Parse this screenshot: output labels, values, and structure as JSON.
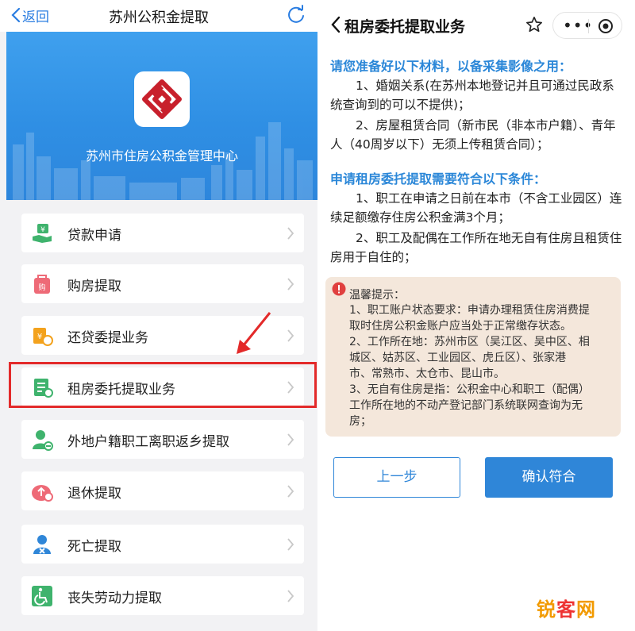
{
  "left": {
    "back_label": "返回",
    "title": "苏州公积金提取",
    "banner_text": "苏州市住房公积金管理中心",
    "menu": [
      {
        "label": "贷款申请",
        "icon": "loan-icon"
      },
      {
        "label": "购房提取",
        "icon": "house-purchase-icon"
      },
      {
        "label": "还贷委提业务",
        "icon": "repayment-icon"
      },
      {
        "label": "租房委托提取业务",
        "icon": "rent-document-icon"
      },
      {
        "label": "外地户籍职工离职返乡提取",
        "icon": "person-leave-icon"
      },
      {
        "label": "退休提取",
        "icon": "retire-icon"
      },
      {
        "label": "死亡提取",
        "icon": "person-death-icon"
      },
      {
        "label": "丧失劳动力提取",
        "icon": "wheelchair-icon"
      }
    ]
  },
  "right": {
    "title": "租房委托提取业务",
    "section1_heading": "请您准备好以下材料，以备采集影像之用：",
    "section1_items": [
      "1、婚姻关系(在苏州本地登记并且可通过民政系统查询到的可以不提供)；",
      "2、房屋租赁合同（新市民（非本市户籍）、青年人（40周岁以下）无须上传租赁合同）；"
    ],
    "section2_heading": "申请租房委托提取需要符合以下条件：",
    "section2_items": [
      "1、职工在申请之日前在本市（不含工业园区）连续足额缴存住房公积金满3个月；",
      "2、职工及配偶在工作所在地无自有住房且租赁住房用于自住的；"
    ],
    "notice": {
      "title": "温馨提示：",
      "lines": [
        "1、职工账户状态要求：申请办理租赁住房消费提",
        "取时住房公积金账户应当处于正常缴存状态。",
        "2、工作所在地：苏州市区（吴江区、吴中区、相",
        "城区、姑苏区、工业园区、虎丘区）、张家港",
        "市、常熟市、太仓市、昆山市。",
        "3、无自有住房是指：公积金中心和职工（配偶）",
        "工作所在地的不动产登记部门系统联网查询为无",
        "房；"
      ]
    },
    "prev_button": "上一步",
    "confirm_button": "确认符合"
  },
  "watermark": {
    "part1": "锐",
    "part2": "客",
    "part3": "网"
  },
  "colors": {
    "accent_blue": "#2f86d8",
    "banner_blue": "#3597e8",
    "highlight_red": "#e32a2a",
    "notice_bg": "#f4e7db"
  }
}
